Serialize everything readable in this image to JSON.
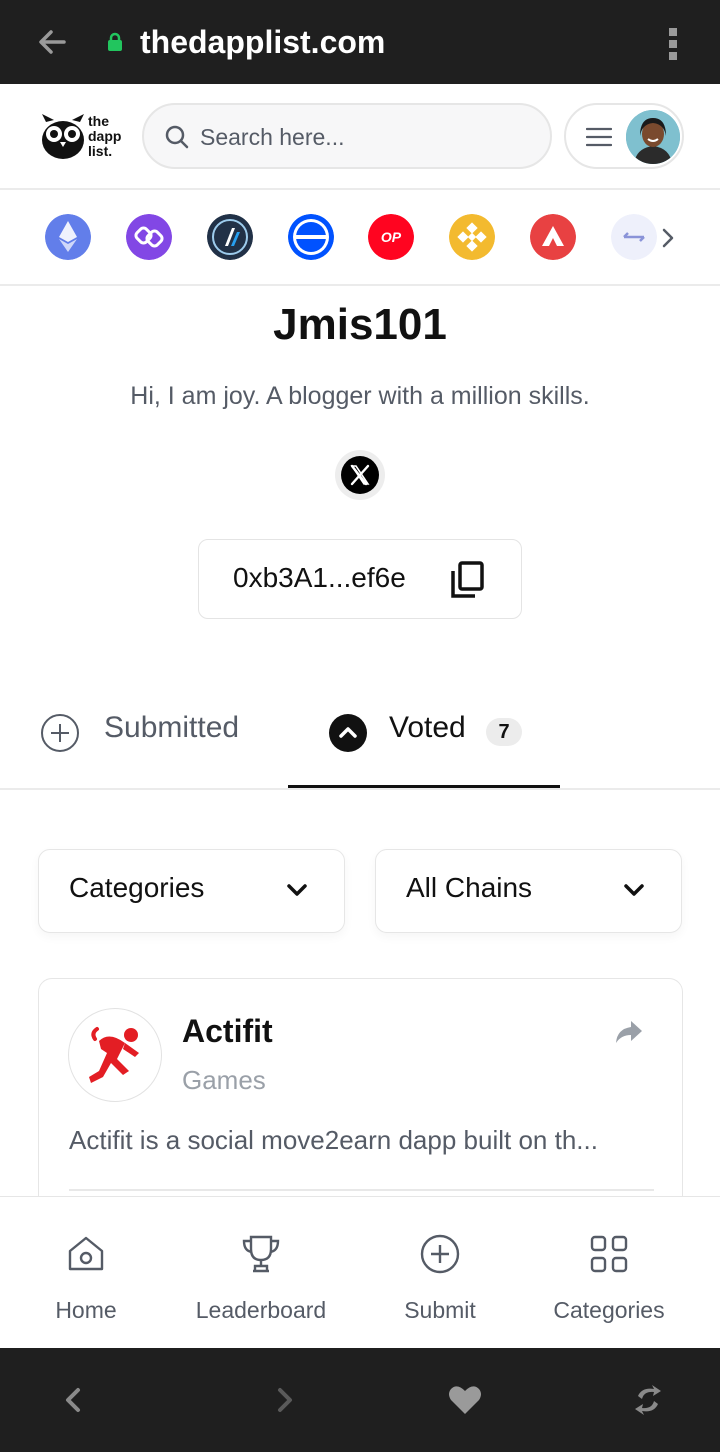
{
  "browser": {
    "url": "thedapplist.com",
    "back_icon": "arrow-left-icon",
    "lock_icon": "lock-icon",
    "menu_icon": "more-vertical-icon"
  },
  "header": {
    "logo_text_line1": "the",
    "logo_text_line2": "dapp",
    "logo_text_line3": "list.",
    "search_placeholder": "Search here...",
    "menu_icon": "hamburger-icon"
  },
  "chains": [
    {
      "name": "ethereum",
      "color": "#627EEA"
    },
    {
      "name": "polygon",
      "color": "#8247E5"
    },
    {
      "name": "arbitrum",
      "color": "#213147"
    },
    {
      "name": "base",
      "color": "#0052FF"
    },
    {
      "name": "optimism",
      "color": "#FF0420",
      "label": "OP"
    },
    {
      "name": "bnb",
      "color": "#F3BA2F"
    },
    {
      "name": "avalanche",
      "color": "#E84142"
    },
    {
      "name": "more",
      "color": "#eef0fb"
    }
  ],
  "profile": {
    "username": "Jmis101",
    "bio": "Hi, I am joy. A blogger with a million skills.",
    "social_icon": "x-logo-icon",
    "wallet": "0xb3A1...ef6e"
  },
  "tabs": [
    {
      "label": "Submitted",
      "active": false
    },
    {
      "label": "Voted",
      "active": true,
      "count": "7"
    }
  ],
  "filters": {
    "categories": "Categories",
    "chains": "All Chains"
  },
  "card": {
    "title": "Actifit",
    "category": "Games",
    "description": "Actifit is a social move2earn dapp built on th...",
    "accent": "#e31e24"
  },
  "bottom_nav": [
    {
      "label": "Home",
      "icon": "home-icon"
    },
    {
      "label": "Leaderboard",
      "icon": "trophy-icon"
    },
    {
      "label": "Submit",
      "icon": "plus-circle-icon"
    },
    {
      "label": "Categories",
      "icon": "grid-icon"
    }
  ],
  "browser_bottom": {
    "icons": [
      "chevron-left-icon",
      "chevron-right-icon",
      "heart-icon",
      "refresh-icon"
    ]
  }
}
